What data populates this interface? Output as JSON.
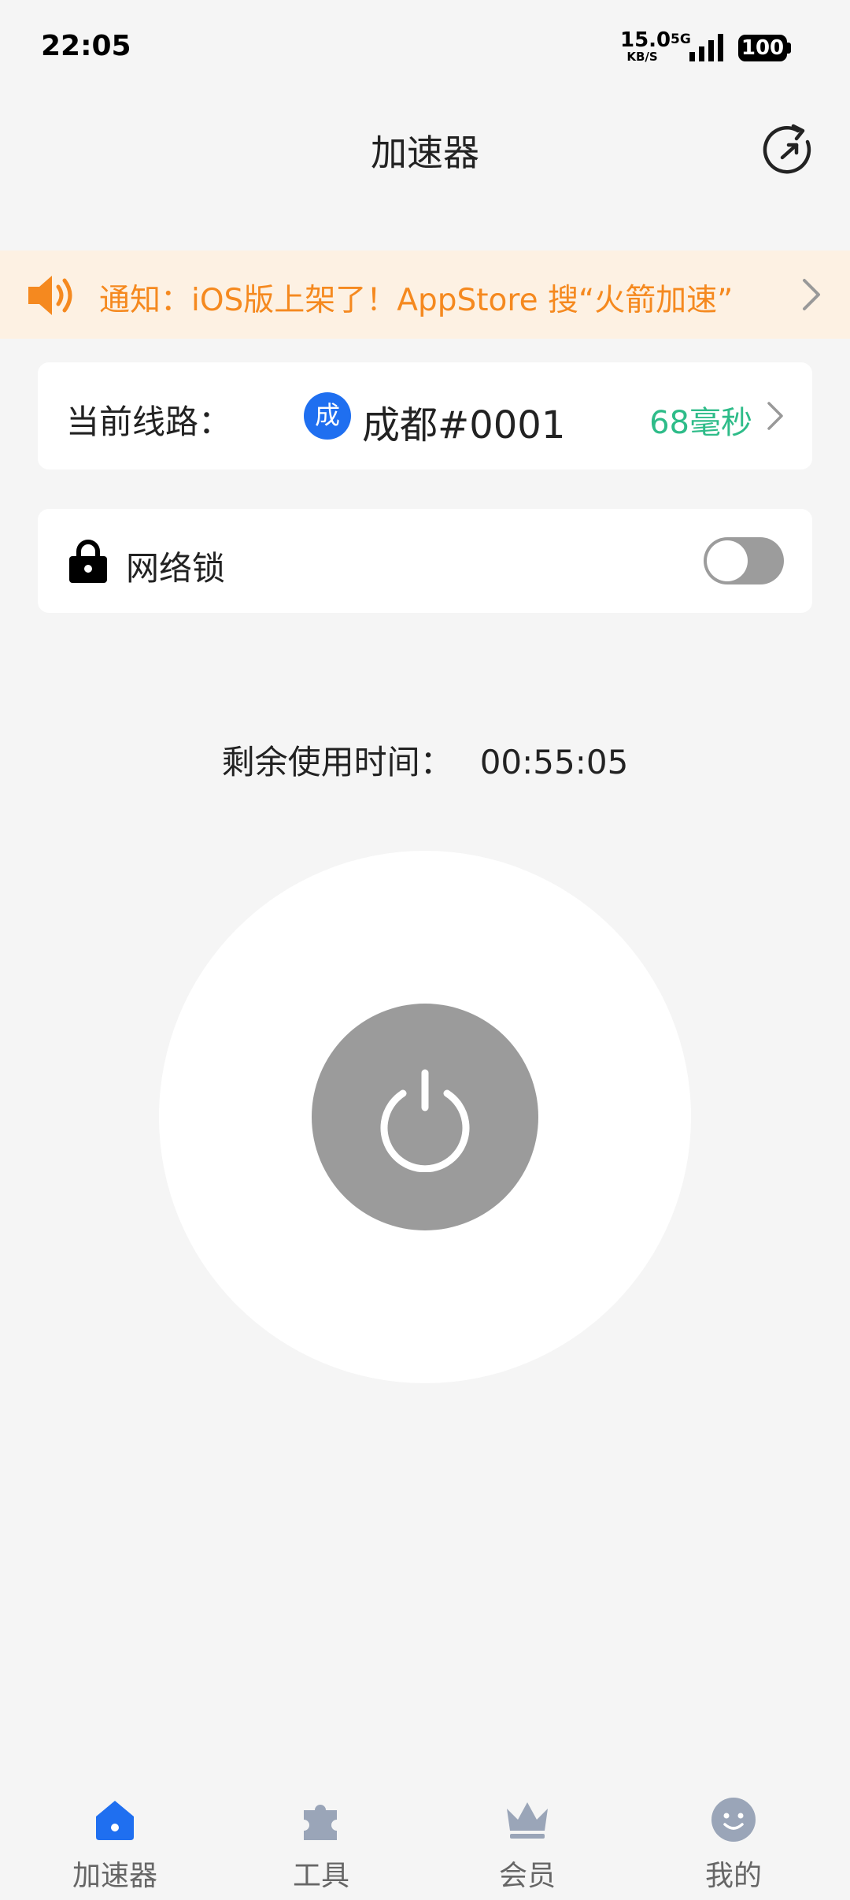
{
  "status_bar": {
    "time": "22:05",
    "net_speed_value": "15.0",
    "net_speed_unit": "KB/S",
    "network_type": "5G",
    "battery": "100"
  },
  "header": {
    "title": "加速器",
    "refresh_icon": "refresh-icon"
  },
  "notice": {
    "text": "通知：iOS版上架了！AppStore 搜“火箭加速”",
    "accent_color": "#f5891f",
    "background": "#fdf1e3"
  },
  "route": {
    "label": "当前线路：",
    "city_badge": "成都",
    "name": "成都#0001",
    "latency": "68毫秒",
    "latency_color": "#2ebc89",
    "badge_color": "#1f6ff0"
  },
  "network_lock": {
    "label": "网络锁",
    "enabled": false
  },
  "remaining": {
    "label": "剩余使用时间：",
    "value": "00:55:05"
  },
  "power": {
    "state": "off",
    "button_color": "#9b9b9b"
  },
  "bottom_nav": {
    "active": "加速器",
    "active_color": "#1f6ff0",
    "inactive_color": "#9aa5b8",
    "items": [
      {
        "label": "加速器",
        "icon": "home-icon"
      },
      {
        "label": "工具",
        "icon": "puzzle-icon"
      },
      {
        "label": "会员",
        "icon": "crown-icon"
      },
      {
        "label": "我的",
        "icon": "smiley-icon"
      }
    ]
  }
}
